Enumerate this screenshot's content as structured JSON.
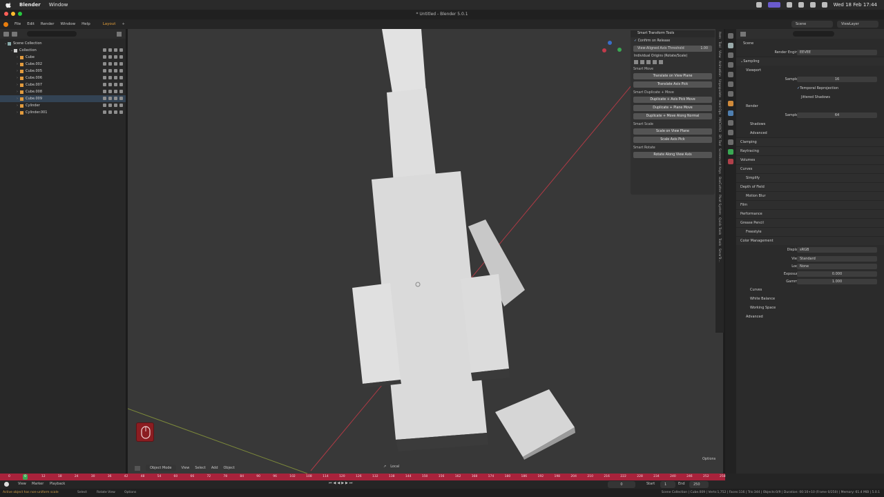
{
  "mac_menubar": {
    "app_name": "Blender",
    "menu_window": "Window",
    "clock": "Wed 18 Feb  17:44"
  },
  "window": {
    "title": "* Untitled - Blender 5.0.1"
  },
  "topbar": {
    "menus": [
      "File",
      "Edit",
      "Render",
      "Window",
      "Help"
    ],
    "workspace_tab": "Layout",
    "scene": "Scene",
    "view_layer": "ViewLayer"
  },
  "outliner": {
    "rows": [
      {
        "label": "Scene Collection",
        "indent": 0,
        "kind": "scene"
      },
      {
        "label": "Collection",
        "indent": 1,
        "kind": "collection"
      },
      {
        "label": "Cube",
        "indent": 2,
        "kind": "mesh"
      },
      {
        "label": "Cube.002",
        "indent": 2,
        "kind": "mesh"
      },
      {
        "label": "Cube.005",
        "indent": 2,
        "kind": "mesh"
      },
      {
        "label": "Cube.006",
        "indent": 2,
        "kind": "mesh"
      },
      {
        "label": "Cube.007",
        "indent": 2,
        "kind": "mesh"
      },
      {
        "label": "Cube.008",
        "indent": 2,
        "kind": "mesh"
      },
      {
        "label": "Cube.009",
        "indent": 2,
        "kind": "mesh"
      },
      {
        "label": "Cylinder",
        "indent": 2,
        "kind": "mesh"
      },
      {
        "label": "Cylinder.001",
        "indent": 2,
        "kind": "mesh"
      }
    ]
  },
  "smart_tools": {
    "title": "Smart Transform Tools",
    "confirm_on_release": "Confirm on Release",
    "threshold_label": "View-Aligned Axis Threshold",
    "threshold_value": "1.00",
    "individual_origins": "Individual Origins (Rotate/Scale)",
    "sections": [
      {
        "title": "Smart Move",
        "buttons": [
          "Translate on View Plane",
          "Translate Axis Pick"
        ]
      },
      {
        "title": "Smart Duplicate + Move",
        "buttons": [
          "Duplicate + Axis Pick Move",
          "Duplicate + Plane Move",
          "Duplicate + Move Along Normal"
        ]
      },
      {
        "title": "Smart Scale",
        "buttons": [
          "Scale on View Plane",
          "Scale Axis Pick"
        ]
      },
      {
        "title": "Smart Rotate",
        "buttons": [
          "Rotate Along View Axis"
        ]
      }
    ]
  },
  "n_tabs": [
    "Item",
    "Tool",
    "View",
    "Animation",
    "Unpopulate",
    "Hard Ops",
    "MACHIN3",
    "BK Tool",
    "Screencast Keys",
    "BoxCutter",
    "Pivot System",
    "Quick Tools",
    "Tools",
    "SmarTr..."
  ],
  "properties": {
    "breadcrumb": "Scene",
    "render_engine_label": "Render Engine",
    "render_engine": "EEVEE",
    "sampling": "Sampling",
    "viewport": "Viewport",
    "samples_label": "Samples",
    "viewport_samples": "16",
    "temporal_reprojection": "Temporal Reprojection",
    "jittered_shadows": "Jittered Shadows",
    "render": "Render",
    "render_samples": "64",
    "shadows": "Shadows",
    "advanced": "Advanced",
    "clamping": "Clamping",
    "raytracing": "Raytracing",
    "volumes": "Volumes",
    "curves": "Curves",
    "simplify": "Simplify",
    "depth_of_field": "Depth of Field",
    "motion_blur": "Motion Blur",
    "film": "Film",
    "performance": "Performance",
    "grease_pencil": "Grease Pencil",
    "freestyle": "Freestyle",
    "color_management": "Color Management",
    "display_label": "Display",
    "display": "sRGB",
    "view_label": "View",
    "view": "Standard",
    "look_label": "Look",
    "look": "None",
    "exposure_label": "Exposure",
    "exposure": "0.000",
    "gamma_label": "Gamma",
    "gamma": "1.000",
    "cm_curves": "Curves",
    "white_balance": "White Balance",
    "working_space": "Working Space",
    "cm_advanced": "Advanced"
  },
  "viewport_header": {
    "mode": "Object Mode",
    "menus": [
      "View",
      "Select",
      "Add",
      "Object"
    ],
    "transform_orientation": "Local",
    "options": "Options"
  },
  "timeline": {
    "ticks": [
      "0",
      "6",
      "12",
      "18",
      "24",
      "30",
      "36",
      "42",
      "48",
      "54",
      "60",
      "66",
      "72",
      "78",
      "84",
      "90",
      "96",
      "102",
      "108",
      "114",
      "120",
      "126",
      "132",
      "138",
      "144",
      "150",
      "156",
      "162",
      "168",
      "174",
      "180",
      "186",
      "192",
      "198",
      "204",
      "210",
      "216",
      "222",
      "228",
      "234",
      "240",
      "246",
      "252",
      "258"
    ],
    "current_frame": "0",
    "menus": [
      "View",
      "Marker",
      "Playback"
    ],
    "frame": "0",
    "start_label": "Start",
    "start": "1",
    "end_label": "End",
    "end": "250"
  },
  "status": {
    "left": "Active object has non-uniform scale",
    "items": [
      "Select",
      "Rotate View",
      "Options"
    ],
    "right": "Scene Collection | Cube.009 | Verts:1,752 | Faces:116 | Tris:344 | Objects:0/9 | Duration: 00:10+10 (Frame 0/250) | Memory: 61.4 MiB | 5.0.1"
  },
  "colors": {
    "accent": "#e39f3a",
    "timeline_red": "#a8223b",
    "playhead_green": "#3aa853"
  }
}
